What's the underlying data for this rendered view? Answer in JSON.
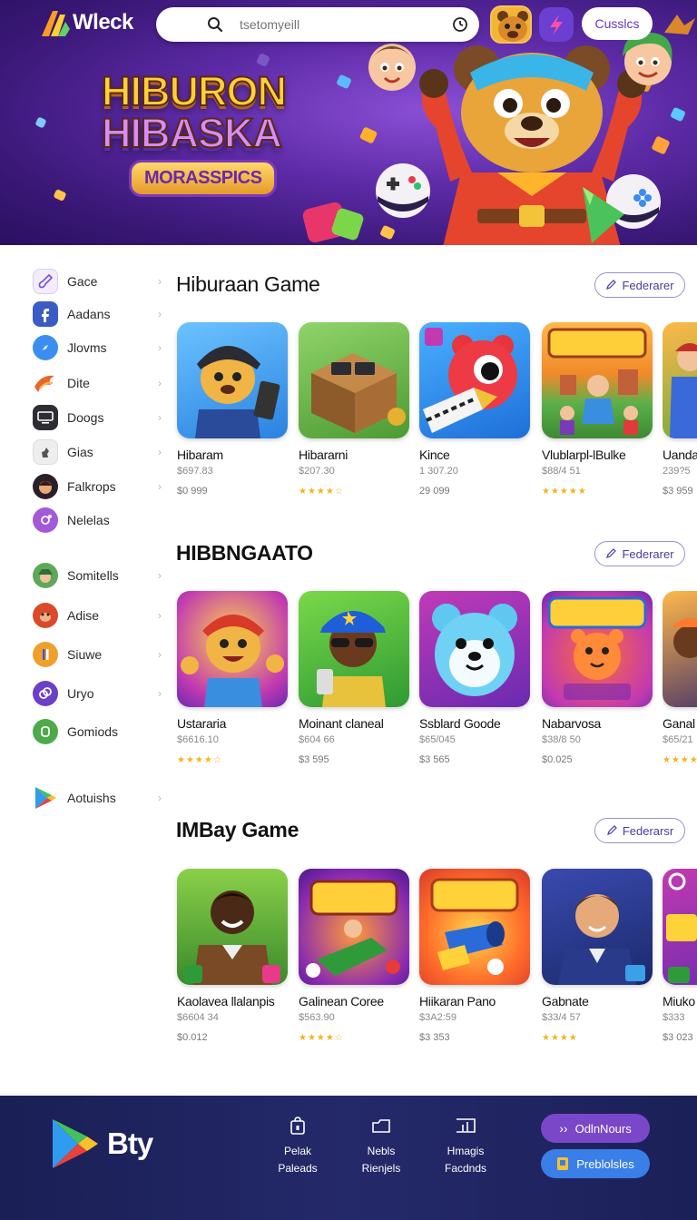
{
  "header": {
    "logo_text": "Wleck",
    "search_placeholder": "tsetomyeill",
    "cta_label": "Cusslcs"
  },
  "hero": {
    "title_line1": "HIBURON",
    "title_line2": "HIBASKA",
    "badge": "MORASSPICS"
  },
  "sidebar": {
    "items": [
      {
        "label": "Gace",
        "icon": "guitar-icon"
      },
      {
        "label": "Aadans",
        "icon": "facebook-icon"
      },
      {
        "label": "Jlovms",
        "icon": "compass-icon"
      },
      {
        "label": "Dite",
        "icon": "swirl-icon"
      },
      {
        "label": "Doogs",
        "icon": "monitor-icon"
      },
      {
        "label": "Gias",
        "icon": "chess-icon"
      },
      {
        "label": "Falkrops",
        "icon": "character-icon"
      },
      {
        "label": "Nelelas",
        "icon": "orbit-icon"
      },
      {
        "label": "Somitells",
        "icon": "explorer-icon"
      },
      {
        "label": "Adise",
        "icon": "monkey-icon"
      },
      {
        "label": "Siuwe",
        "icon": "game-icon"
      },
      {
        "label": "Uryo",
        "icon": "link-icon"
      },
      {
        "label": "Gomiods",
        "icon": "fox-icon"
      },
      {
        "label": "Aotuishs",
        "icon": "play-store-icon"
      }
    ]
  },
  "sections": [
    {
      "title": "Hiburaan Game",
      "featured_label": "Federarer",
      "cards": [
        {
          "name": "Hibaram",
          "sub": "$697.83",
          "foot": "$0 999",
          "stars": ""
        },
        {
          "name": "Hibararni",
          "sub": "$207.30",
          "foot": "",
          "stars": "★★★★☆"
        },
        {
          "name": "Kince",
          "sub": "1 307.20",
          "foot": "29 099",
          "stars": ""
        },
        {
          "name": "Vlublarpl-lBulke",
          "sub": "$88/4 51",
          "foot": "",
          "stars": "★★★★★"
        },
        {
          "name": "Uanda",
          "sub": "239?5",
          "foot": "$3 959",
          "stars": ""
        }
      ]
    },
    {
      "title": "HIBBNGAATO",
      "featured_label": "Federarer",
      "cards": [
        {
          "name": "Ustararia",
          "sub": "$6616.10",
          "foot": "",
          "stars": "★★★★☆"
        },
        {
          "name": "Moinant claneal",
          "sub": "$604 66",
          "foot": "$3 595",
          "stars": ""
        },
        {
          "name": "Ssblard Goode",
          "sub": "$65/045",
          "foot": "$3 565",
          "stars": ""
        },
        {
          "name": "Nabarvosa",
          "sub": "$38/8 50",
          "foot": "$0.025",
          "stars": ""
        },
        {
          "name": "Ganal",
          "sub": "$65/21",
          "foot": "",
          "stars": "★★★★"
        }
      ]
    },
    {
      "title": "IMBay Game",
      "featured_label": "Federarsr",
      "cards": [
        {
          "name": "Kaolavea llalanpis",
          "sub": "$6604 34",
          "foot": "$0.012",
          "stars": ""
        },
        {
          "name": "Galinean Coree",
          "sub": "$563.90",
          "foot": "",
          "stars": "★★★★☆"
        },
        {
          "name": "Hiikaran Pano",
          "sub": "$3A2:59",
          "foot": "$3 353",
          "stars": ""
        },
        {
          "name": "Gabnate",
          "sub": "$33/4 57",
          "foot": "",
          "stars": "★★★★"
        },
        {
          "name": "Miuko",
          "sub": "$333",
          "foot": "$3 023",
          "stars": ""
        }
      ]
    }
  ],
  "footer": {
    "logo_text": "Bty",
    "links": [
      {
        "line1": "Pelak",
        "line2": "Paleads"
      },
      {
        "line1": "Nebls",
        "line2": "Rienjels"
      },
      {
        "line1": "Hmagis",
        "line2": "Facdnds"
      }
    ],
    "btn1": "OdlnNours",
    "btn2": "Preblolsles"
  },
  "colors": {
    "hero_bg": "#4a1f8f",
    "accent": "#6a35c6",
    "footer_bg": "#1f2460",
    "star": "#f2b51c"
  }
}
